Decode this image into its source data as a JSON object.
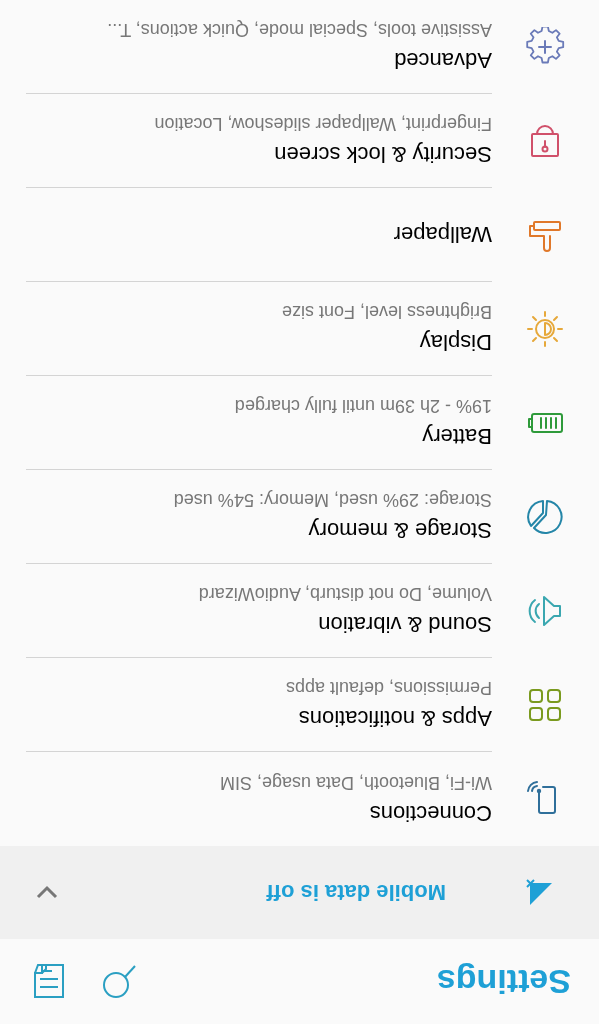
{
  "header": {
    "title": "Settings"
  },
  "banner": {
    "text": "Mobile data is off"
  },
  "items": [
    {
      "title": "Connections",
      "subtitle": "Wi-Fi, Bluetooth, Data usage, SIM"
    },
    {
      "title": "Apps & notifications",
      "subtitle": "Permissions, default apps"
    },
    {
      "title": "Sound & vibration",
      "subtitle": "Volume, Do not disturb, AudioWizard"
    },
    {
      "title": "Storage & memory",
      "subtitle": "Storage: 29% used, Memory: 54% used"
    },
    {
      "title": "Battery",
      "subtitle": "19% - 2h 39m until fully charged"
    },
    {
      "title": "Display",
      "subtitle": "Brightness level, Font size"
    },
    {
      "title": "Wallpaper"
    },
    {
      "title": "Security & lock screen",
      "subtitle": "Fingerprint, Wallpaper slideshow, Location"
    },
    {
      "title": "Advanced",
      "subtitle": "Assistive tools, Special mode, Quick actions, T..."
    }
  ]
}
